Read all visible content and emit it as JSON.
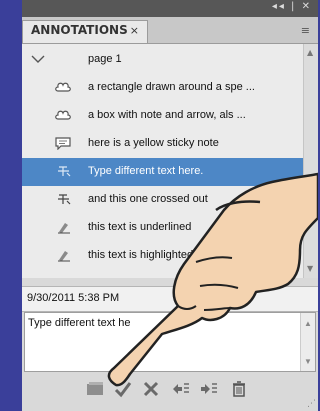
{
  "titlebar": {
    "controls": "◂◂ | ✕"
  },
  "tab": {
    "label": "ANNOTATIONS",
    "close": "×",
    "menu_icon": "≡"
  },
  "list": {
    "items": [
      {
        "label": "page 1",
        "icon": "chevron-down-icon",
        "selected": false
      },
      {
        "label": "a rectangle drawn around a spe ...",
        "icon": "cloud-shape-icon",
        "selected": false
      },
      {
        "label": "a box with note and arrow, als ...",
        "icon": "cloud-shape-icon",
        "selected": false
      },
      {
        "label": "here is a yellow sticky note",
        "icon": "sticky-note-icon",
        "selected": false
      },
      {
        "label": "Type different text here.",
        "icon": "text-replace-icon",
        "selected": true
      },
      {
        "label": "and this one crossed out",
        "icon": "strikethrough-icon",
        "selected": false
      },
      {
        "label": "this text is underlined",
        "icon": "underline-highlight-icon",
        "selected": false
      },
      {
        "label": "this text is highlighted",
        "icon": "highlight-marker-icon",
        "selected": false
      }
    ]
  },
  "detail": {
    "timestamp": "9/30/2011 5:38 PM",
    "note_text": "Type different text he"
  },
  "toolbar": {
    "buttons": [
      "comment-icon",
      "accept-check-icon",
      "reject-x-icon",
      "reply-icon",
      "set-status-icon",
      "delete-trash-icon"
    ]
  },
  "colors": {
    "background": "#3a3f9a",
    "selection": "#4d87c6",
    "panel": "#d9d9d9"
  }
}
